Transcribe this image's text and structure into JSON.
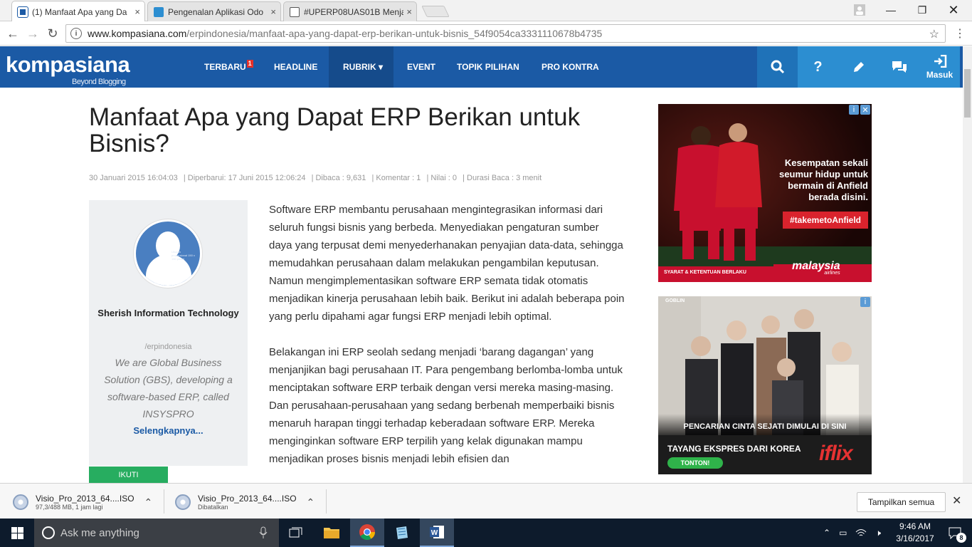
{
  "browser": {
    "tabs": [
      {
        "title": "(1) Manfaat Apa yang Da",
        "icon": "kompasiana-favicon",
        "active": true
      },
      {
        "title": "Pengenalan Aplikasi Odo",
        "icon": "odoo-favicon",
        "active": false
      },
      {
        "title": "#UPERP08UAS01B Menja",
        "icon": "book-favicon",
        "active": false
      }
    ],
    "close_glyph": "×",
    "url_host": "www.kompasiana.com",
    "url_path": "/erpindonesia/manfaat-apa-yang-dapat-erp-berikan-untuk-bisnis_54f9054ca3331110678b4735"
  },
  "site": {
    "logo": "kompasiana",
    "tagline": "Beyond Blogging",
    "nav": [
      {
        "label": "TERBARU",
        "badge": "1"
      },
      {
        "label": "HEADLINE"
      },
      {
        "label": "RUBRIK ▾"
      },
      {
        "label": "EVENT"
      },
      {
        "label": "TOPIK PILIHAN"
      },
      {
        "label": "PRO KONTRA"
      }
    ],
    "help_label": "?",
    "login_label": "Masuk",
    "brand_color": "#1b5aa5"
  },
  "article": {
    "title": "Manfaat Apa yang Dapat ERP Berikan untuk Bisnis?",
    "meta": {
      "published": "30 Januari 2015 16:04:03",
      "updated": "| Diperbarui: 17 Juni 2015 12:06:24",
      "reads": "| Dibaca : 9,631",
      "comments": "| Komentar : 1",
      "rating": "| Nilai : 0",
      "read_time": "| Durasi Baca : 3 menit"
    },
    "paragraphs": [
      "Software ERP membantu perusahaan mengintegrasikan informasi dari seluruh fungsi bisnis yang berbeda. Menyediakan pengaturan sumber daya yang terpusat demi menyederhanakan penyajian data-data, sehingga memudahkan perusahaan dalam melakukan pengambilan keputusan. Namun mengimplementasikan software ERP semata tidak otomatis menjadikan kinerja perusahaan lebih baik. Berikut ini adalah beberapa poin yang perlu dipahami agar fungsi ERP menjadi lebih optimal.",
      "Belakangan ini ERP seolah sedang menjadi ‘barang dagangan’ yang menjanjikan bagi perusahaan IT. Para pengembang berlomba-lomba untuk menciptakan software ERP terbaik dengan versi mereka masing-masing. Dan perusahaan-perusahaan yang sedang berbenah memperbaiki bisnis menaruh harapan tinggi terhadap keberadaan software ERP. Mereka menginginkan software ERP terpilih yang kelak digunakan mampu menjadikan proses bisnis menjadi lebih efisien dan"
    ]
  },
  "author": {
    "avatar_note": "Ukuran proporsional 150 x 150 piksel",
    "name": "Sherish Information Technology",
    "handle": "/erpindonesia",
    "bio": "We are Global Business Solution (GBS), developing a software-based ERP, called INSYSPRO",
    "more": "Selengkapnya...",
    "follow": "IKUTI"
  },
  "ads": {
    "ad1": {
      "headline": "Kesempatan sekali seumur hidup untuk bermain di Anfield berada disini.",
      "hashtag": "#takemetoAnfield",
      "footer": "SYARAT & KETENTUAN BERLAKU",
      "brand": "malaysia",
      "brand_sub": "airlines"
    },
    "ad2": {
      "show": "GOBLIN",
      "tagline": "PENCARIAN CINTA SEJATI DIMULAI DI SINI",
      "promo": "TAYANG EKSPRES DARI KOREA",
      "cta": "TONTON!",
      "brand": "iflix"
    }
  },
  "downloads": {
    "items": [
      {
        "name": "Visio_Pro_2013_64....ISO",
        "status": "97,3/488 MB, 1 jam lagi"
      },
      {
        "name": "Visio_Pro_2013_64....ISO",
        "status": "Dibatalkan"
      }
    ],
    "show_all": "Tampilkan semua",
    "close_glyph": "✕"
  },
  "taskbar": {
    "search_placeholder": "Ask me anything",
    "time": "9:46 AM",
    "date": "3/16/2017",
    "notifications": "8"
  }
}
